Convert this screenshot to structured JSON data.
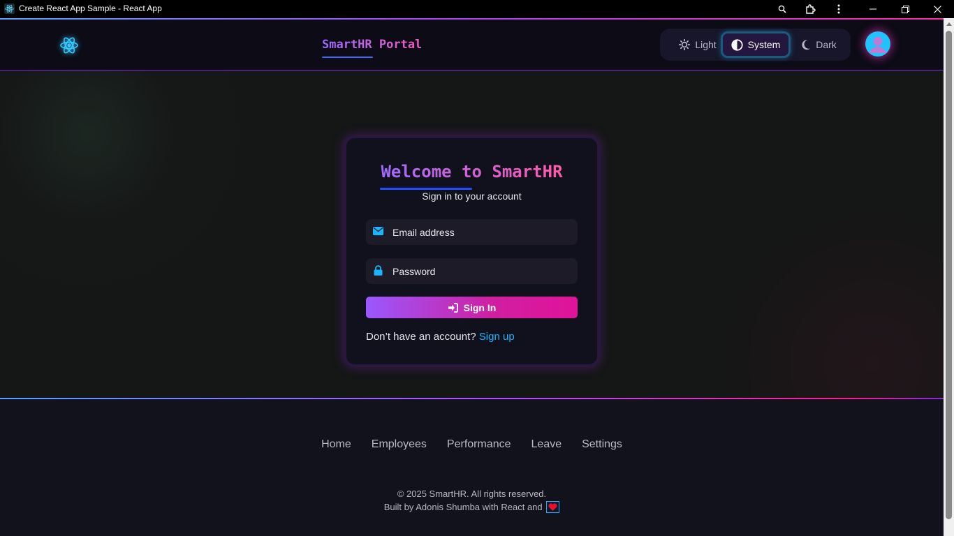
{
  "window": {
    "title": "Create React App Sample - React App",
    "buttons": [
      "zoom-icon",
      "extensions-icon",
      "more-icon",
      "minimize-icon",
      "restore-icon",
      "close-icon"
    ]
  },
  "header": {
    "brand": "SmartHR Portal",
    "theme_options": {
      "light": "Light",
      "system": "System",
      "dark": "Dark"
    },
    "theme_selected": "System",
    "logo_icon": "react-logo-icon",
    "avatar_icon": "user-avatar-icon"
  },
  "login": {
    "title": "Welcome to SmartHR",
    "subtitle": "Sign in to your account",
    "email_placeholder": "Email address",
    "password_placeholder": "Password",
    "signin_label": "Sign In",
    "signup_prompt": "Don’t have an account?",
    "signup_link": "Sign up"
  },
  "footer": {
    "nav": [
      "Home",
      "Employees",
      "Performance",
      "Leave",
      "Settings"
    ],
    "copyright": "© 2025 SmartHR. All rights reserved.",
    "built_by": "Built by Adonis Shumba with React and"
  },
  "colors": {
    "accent_cyan": "#18b6ff",
    "gradient_purple": "#9a58ff",
    "gradient_pink": "#e0139a",
    "background": "#151616"
  }
}
